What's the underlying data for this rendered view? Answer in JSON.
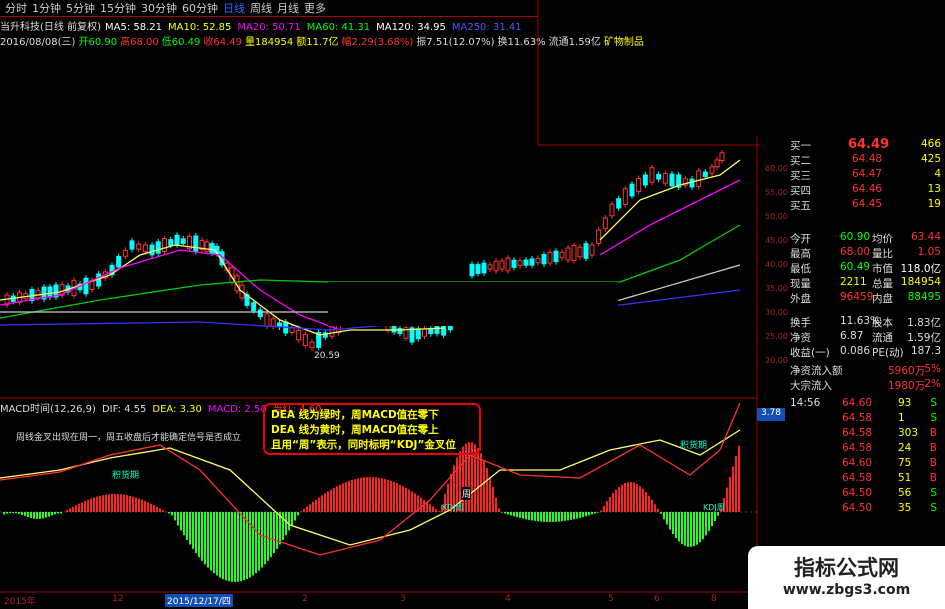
{
  "toolbar": {
    "periods": [
      "分时",
      "1分钟",
      "5分钟",
      "15分钟",
      "30分钟",
      "60分钟",
      "日线",
      "周线",
      "月线",
      "更多"
    ],
    "active_index": 6,
    "more_arrow": "更多 >"
  },
  "header": {
    "stock_name": "当升科技(日线 前复权)",
    "ma": [
      {
        "label": "MA5: 58.21",
        "color": "#ffffff"
      },
      {
        "label": "MA10: 52.85",
        "color": "#ffff00"
      },
      {
        "label": "MA20: 50.71",
        "color": "#ff00ff"
      },
      {
        "label": "MA60: 41.31",
        "color": "#00ff00"
      },
      {
        "label": "MA120: 34.95",
        "color": "#ffffff"
      },
      {
        "label": "MA250: 31.41",
        "color": "#5555ff"
      }
    ],
    "ohlc": [
      {
        "label": "2016/08/08(三)",
        "color": "#dddddd"
      },
      {
        "label": "开60.90",
        "color": "#00ff00"
      },
      {
        "label": "高68.00",
        "color": "#ff3333"
      },
      {
        "label": "低60.49",
        "color": "#00ff00"
      },
      {
        "label": "收64.49",
        "color": "#ff3333"
      },
      {
        "label": "量184954",
        "color": "#ffff00"
      },
      {
        "label": "额11.7亿",
        "color": "#ffff00"
      },
      {
        "label": "幅2.29(3.68%)",
        "color": "#ff3333"
      },
      {
        "label": "振7.51(12.07%)",
        "color": "#dddddd"
      },
      {
        "label": "换11.63%",
        "color": "#dddddd"
      },
      {
        "label": "流通1.59亿",
        "color": "#dddddd"
      },
      {
        "label": "矿物制品",
        "color": "#ffff00"
      }
    ]
  },
  "price_axis": [
    "60.00",
    "55.00",
    "50.00",
    "45.00",
    "40.00",
    "35.00",
    "30.00",
    "25.00",
    "20.00"
  ],
  "low_label": "20.59",
  "macd_header": [
    {
      "label": "MACD时间(12,26,9)",
      "color": "#dddddd"
    },
    {
      "label": "DIF: 4.55",
      "color": "#dddddd"
    },
    {
      "label": "DEA: 3.30",
      "color": "#ffff00"
    },
    {
      "label": "MACD: 2.50",
      "color": "#ff00ff"
    },
    {
      "label": "当红: 4.60",
      "color": "#ff3333"
    }
  ],
  "macd_note": "周线金叉出现在周一，周五收盘后才能确定信号是否成立",
  "infobox": {
    "line1_pre": "DEA 线为绿时，",
    "line1_post": "周MACD值在零下",
    "line2": "DEA 线为黄时，周MACD值在零上",
    "line3": "且用“周”表示，同时标明“KDJ”金叉位"
  },
  "chart_labels": {
    "jixu1": "积货期",
    "jixu2": "积货期",
    "zhou": "周",
    "kdj": "KDJ周",
    "kdj2": "KDJ周"
  },
  "macd_axis": [
    "3.78",
    "0"
  ],
  "date_axis": {
    "items": [
      "2015年",
      "12",
      "2015/12/17/四",
      "2",
      "3",
      "4",
      "5",
      "6",
      "8"
    ]
  },
  "order_book": {
    "bids": [
      {
        "label": "买一",
        "price": "64.49",
        "vol": "466"
      },
      {
        "label": "买二",
        "price": "64.48",
        "vol": "425"
      },
      {
        "label": "买三",
        "price": "64.47",
        "vol": "4"
      },
      {
        "label": "买四",
        "price": "64.46",
        "vol": "13"
      },
      {
        "label": "买五",
        "price": "64.45",
        "vol": "19"
      }
    ]
  },
  "quote": [
    {
      "k1": "今开",
      "v1": "60.90",
      "c1": "#00ff00",
      "k2": "均价",
      "v2": "63.44",
      "c2": "#ff3333"
    },
    {
      "k1": "最高",
      "v1": "68.00",
      "c1": "#ff3333",
      "k2": "量比",
      "v2": "1.05",
      "c2": "#ff3333"
    },
    {
      "k1": "最低",
      "v1": "60.49",
      "c1": "#00ff00",
      "k2": "市值",
      "v2": "118.0亿",
      "c2": "#ffffff"
    },
    {
      "k1": "现量",
      "v1": "2211",
      "c1": "#ffff00",
      "k2": "总量",
      "v2": "184954",
      "c2": "#ffff00"
    },
    {
      "k1": "外盘",
      "v1": "96459",
      "c1": "#ff3333",
      "k2": "内盘",
      "v2": "88495",
      "c2": "#00ff00"
    }
  ],
  "fundamentals": [
    {
      "k1": "换手",
      "v1": "11.63%",
      "k2": "股本",
      "v2": "1.83亿"
    },
    {
      "k1": "净资",
      "v1": "6.87",
      "k2": "流通",
      "v2": "1.59亿"
    },
    {
      "k1": "收益(一)",
      "v1": "0.086",
      "k2": "PE(动)",
      "v2": "187.3"
    }
  ],
  "flows": [
    {
      "label": "净资流入额",
      "value": "5960万",
      "pct": "5%"
    },
    {
      "label": "大宗流入",
      "value": "1980万",
      "pct": "2%"
    }
  ],
  "ticks": [
    {
      "time": "14:56",
      "price": "64.60",
      "vol": "93",
      "dir": "S"
    },
    {
      "time": "",
      "price": "64.58",
      "vol": "1",
      "dir": "S"
    },
    {
      "time": "",
      "price": "64.58",
      "vol": "303",
      "dir": "B"
    },
    {
      "time": "",
      "price": "64.58",
      "vol": "24",
      "dir": "B"
    },
    {
      "time": "",
      "price": "64.60",
      "vol": "75",
      "dir": "B"
    },
    {
      "time": "",
      "price": "64.58",
      "vol": "51",
      "dir": "B"
    },
    {
      "time": "",
      "price": "64.50",
      "vol": "56",
      "dir": "S"
    },
    {
      "time": "",
      "price": "64.50",
      "vol": "35",
      "dir": "S"
    }
  ],
  "watermark": {
    "line1": "指标公式网",
    "line2": "www.zbgs3.com"
  }
}
